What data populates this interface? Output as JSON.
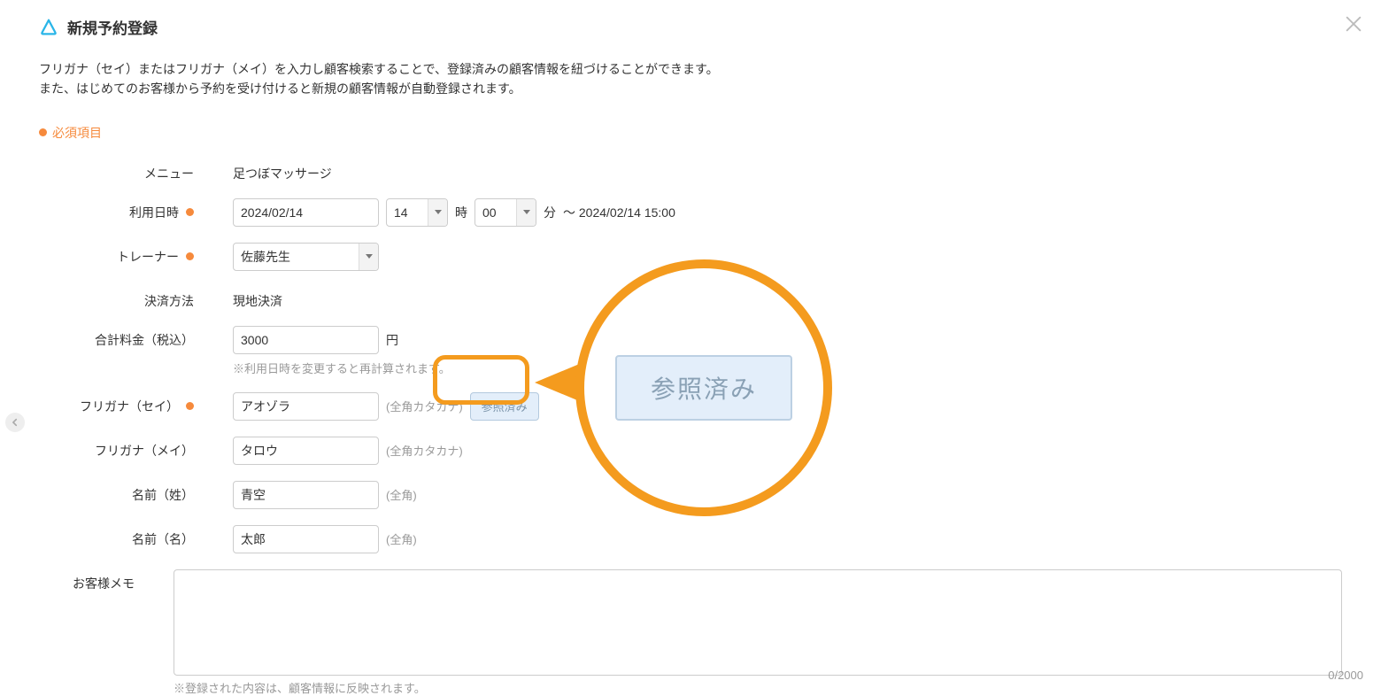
{
  "header": {
    "title": "新規予約登録"
  },
  "intro": {
    "line1": "フリガナ（セイ）またはフリガナ（メイ）を入力し顧客検索することで、登録済みの顧客情報を紐づけることができます。",
    "line2": "また、はじめてのお客様から予約を受け付けると新規の顧客情報が自動登録されます。"
  },
  "required_legend": "必須項目",
  "fields": {
    "menu": {
      "label": "メニュー",
      "value": "足つぼマッサージ"
    },
    "datetime": {
      "label": "利用日時",
      "date": "2024/02/14",
      "hour": "14",
      "hour_unit": "時",
      "minute": "00",
      "minute_unit": "分",
      "range_suffix": "～ 2024/02/14 15:00"
    },
    "trainer": {
      "label": "トレーナー",
      "value": "佐藤先生"
    },
    "payment": {
      "label": "決済方法",
      "value": "現地決済"
    },
    "total": {
      "label": "合計料金（税込）",
      "value": "3000",
      "unit": "円",
      "note": "※利用日時を変更すると再計算されます。"
    },
    "furi_sei": {
      "label": "フリガナ（セイ）",
      "value": "アオゾラ",
      "hint": "(全角カタカナ)",
      "ref_button": "参照済み"
    },
    "furi_mei": {
      "label": "フリガナ（メイ）",
      "value": "タロウ",
      "hint": "(全角カタカナ)"
    },
    "name_sei": {
      "label": "名前（姓）",
      "value": "青空",
      "hint": "(全角)"
    },
    "name_mei": {
      "label": "名前（名）",
      "value": "太郎",
      "hint": "(全角)"
    },
    "memo": {
      "label": "お客様メモ",
      "value": "",
      "note": "※登録された内容は、顧客情報に反映されます。",
      "counter": "0/2000"
    }
  },
  "callout": {
    "label": "参照済み"
  }
}
